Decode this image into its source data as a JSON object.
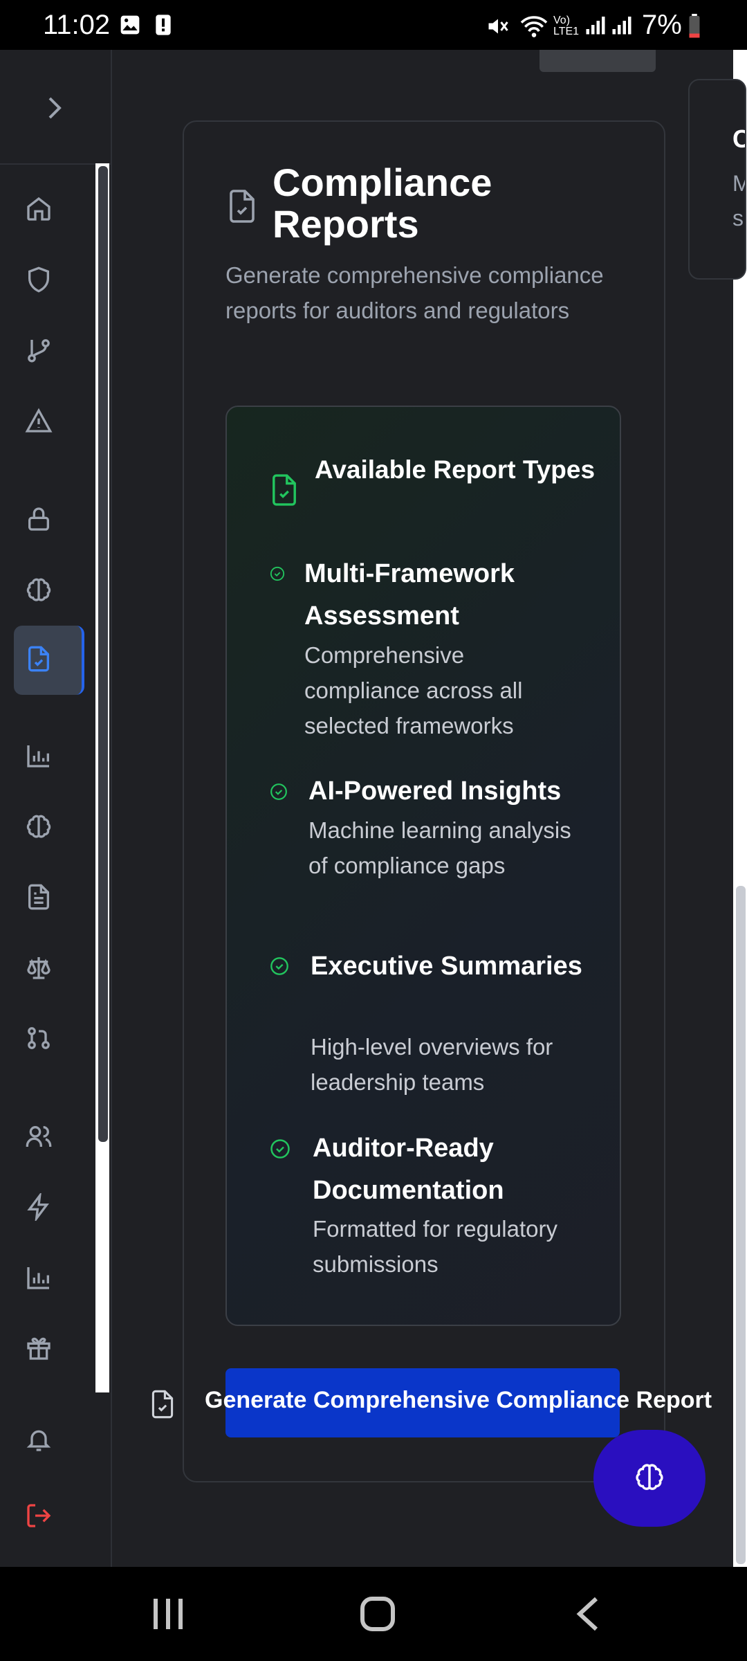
{
  "status_bar": {
    "time": "11:02",
    "battery": "7%"
  },
  "sidebar": {
    "items": [
      {
        "icon": "home-icon"
      },
      {
        "icon": "shield-icon"
      },
      {
        "icon": "git-branch-icon"
      },
      {
        "icon": "alert-triangle-icon"
      },
      {
        "icon": "lock-icon"
      },
      {
        "icon": "brain-icon"
      },
      {
        "icon": "file-check-icon",
        "active": true
      },
      {
        "icon": "bar-chart-icon"
      },
      {
        "icon": "brain-icon"
      },
      {
        "icon": "file-text-icon"
      },
      {
        "icon": "scale-icon"
      },
      {
        "icon": "git-pull-request-icon"
      },
      {
        "icon": "users-icon"
      },
      {
        "icon": "zap-icon"
      },
      {
        "icon": "bar-chart-icon"
      },
      {
        "icon": "gift-icon"
      }
    ],
    "footer": [
      {
        "icon": "bell-icon"
      },
      {
        "icon": "log-out-icon",
        "color": "#ef4444"
      }
    ]
  },
  "peek_card": {
    "title": "C",
    "desc_line1": "M",
    "desc_line2": "su"
  },
  "card": {
    "title": "Compliance Reports",
    "description": "Generate comprehensive compliance reports for auditors and regulators",
    "report_types": {
      "title": "Available Report Types",
      "items": [
        {
          "title": "Multi-Framework Assessment",
          "description": "Comprehensive compliance across all selected frameworks"
        },
        {
          "title": "AI-Powered Insights",
          "description": "Machine learning analysis of compliance gaps"
        },
        {
          "title": "Executive Summaries",
          "description": "High-level overviews for leadership teams"
        },
        {
          "title": "Auditor-Ready Documentation",
          "description": "Formatted for regulatory submissions"
        }
      ]
    },
    "generate_button": "Generate Comprehensive Compliance Report"
  },
  "colors": {
    "accent_green": "#22c55e",
    "button_blue": "#0a36c9",
    "fab_purple": "#2a0fbf",
    "active_border": "#2563eb",
    "logout_red": "#ef4444"
  }
}
